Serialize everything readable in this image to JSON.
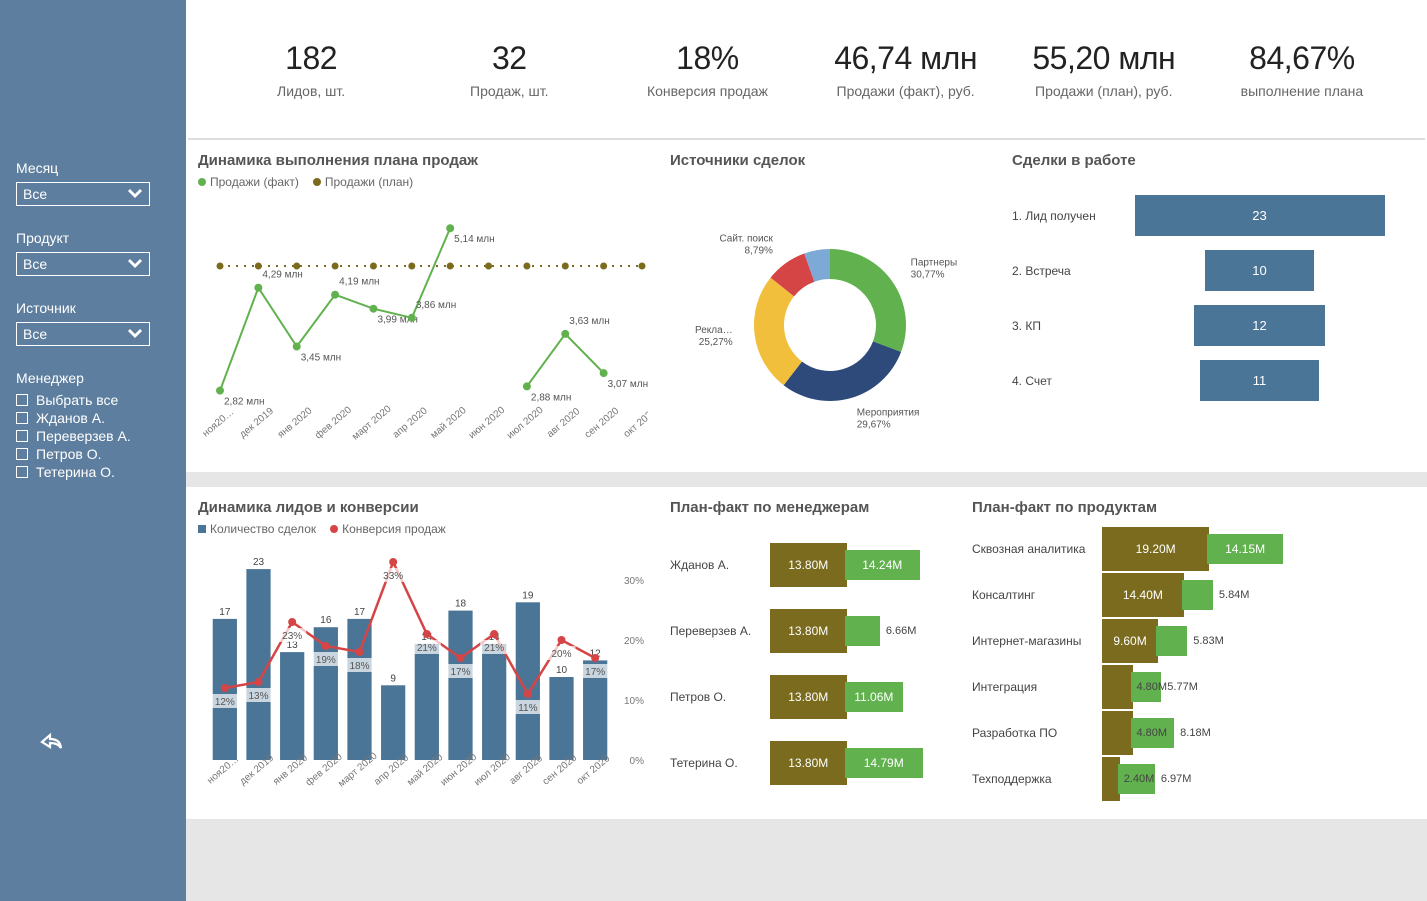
{
  "sidebar": {
    "filters": {
      "month_label": "Месяц",
      "month_value": "Все",
      "product_label": "Продукт",
      "product_value": "Все",
      "source_label": "Источник",
      "source_value": "Все",
      "manager_label": "Менеджер",
      "managers": [
        "Выбрать все",
        "Жданов А.",
        "Переверзев А.",
        "Петров О.",
        "Тетерина О."
      ]
    }
  },
  "kpis": [
    {
      "value": "182",
      "label": "Лидов, шт."
    },
    {
      "value": "32",
      "label": "Продаж, шт."
    },
    {
      "value": "18%",
      "label": "Конверсия продаж"
    },
    {
      "value": "46,74 млн",
      "label": "Продажи (факт), руб."
    },
    {
      "value": "55,20 млн",
      "label": "Продажи (план), руб."
    },
    {
      "value": "84,67%",
      "label": "выполнение плана"
    }
  ],
  "titles": {
    "dynamics_plan": "Динамика выполнения плана продаж",
    "sources": "Источники сделок",
    "funnel": "Сделки в работе",
    "leads_conv": "Динамика лидов и конверсии",
    "pf_managers": "План-факт по менеджерам",
    "pf_products": "План-факт по продуктам"
  },
  "legends": {
    "plan_fact": {
      "fact": "Продажи (факт)",
      "plan": "Продажи (план)"
    },
    "leads_conv": {
      "deals": "Количество сделок",
      "conv": "Конверсия продаж"
    }
  },
  "chart_data": [
    {
      "id": "dynamics_plan",
      "type": "line",
      "title": "Динамика выполнения плана продаж",
      "x": [
        "ноя20…",
        "дек 2019",
        "янв 2020",
        "фев 2020",
        "март 2020",
        "апр 2020",
        "май 2020",
        "июн 2020",
        "июл 2020",
        "авг 2020",
        "сен 2020",
        "окт 2020"
      ],
      "series": [
        {
          "name": "Продажи (факт)",
          "color": "#62b14f",
          "values": [
            2.82,
            4.29,
            3.45,
            4.19,
            3.99,
            3.86,
            5.14,
            null,
            2.88,
            3.63,
            3.07,
            null
          ],
          "data_labels": [
            "2,82 млн",
            "4,29 млн",
            "3,45 млн",
            "4,19 млн",
            "3,99 млн",
            "3,86 млн",
            "5,14 млн",
            "",
            "2,88 млн",
            "3,63 млн",
            "3,07 млн",
            ""
          ]
        },
        {
          "name": "Продажи (план)",
          "color": "#7a6b1e",
          "values": [
            4.6,
            4.6,
            4.6,
            4.6,
            4.6,
            4.6,
            4.6,
            4.6,
            4.6,
            4.6,
            4.6,
            4.6
          ],
          "style": "dashed"
        }
      ],
      "ylim": [
        2.5,
        5.5
      ],
      "y_unit": "млн"
    },
    {
      "id": "sources",
      "type": "pie",
      "title": "Источники сделок",
      "slices": [
        {
          "name": "Партнеры",
          "value": 30.77,
          "label": "30,77%",
          "color": "#62b14f"
        },
        {
          "name": "Мероприятия",
          "value": 29.67,
          "label": "29,67%",
          "color": "#2e4a7a"
        },
        {
          "name": "Рекла…",
          "value": 25.27,
          "label": "25,27%",
          "color": "#f2bf3d"
        },
        {
          "name": "Сайт. поиск",
          "value": 8.79,
          "label": "8,79%",
          "color": "#d64545"
        },
        {
          "name": "",
          "value": 5.5,
          "label": "",
          "color": "#7da9d6"
        }
      ]
    },
    {
      "id": "funnel",
      "type": "bar",
      "title": "Сделки в работе",
      "rows": [
        {
          "label": "1. Лид получен",
          "value": 23
        },
        {
          "label": "2. Встреча",
          "value": 10
        },
        {
          "label": "3. КП",
          "value": 12
        },
        {
          "label": "4. Счет",
          "value": 11
        }
      ]
    },
    {
      "id": "leads_conv",
      "type": "bar+line",
      "title": "Динамика лидов и конверсии",
      "x": [
        "ноя20…",
        "дек 2019",
        "янв 2020",
        "фев 2020",
        "март 2020",
        "апр 2020",
        "май 2020",
        "июн 2020",
        "июл 2020",
        "авг 2020",
        "сен 2020",
        "окт 2020"
      ],
      "bar_series": {
        "name": "Количество сделок",
        "color": "#4b7597",
        "values": [
          17,
          23,
          13,
          16,
          17,
          9,
          14,
          18,
          14,
          19,
          10,
          12
        ],
        "labels": [
          "17",
          "23",
          "13",
          "16",
          "17",
          "9",
          "14",
          "18",
          "14",
          "19",
          "10",
          "12"
        ]
      },
      "line_series": {
        "name": "Конверсия продаж",
        "color": "#d64545",
        "values": [
          12,
          13,
          23,
          19,
          18,
          33,
          21,
          17,
          21,
          11,
          20,
          17
        ],
        "labels": [
          "12%",
          "13%",
          "23%",
          "19%",
          "18%",
          "33%",
          "21%",
          "17%",
          "21%",
          "11%",
          "20%",
          "17%"
        ]
      },
      "right_axis_ticks": [
        "0%",
        "10%",
        "20%",
        "30%"
      ]
    },
    {
      "id": "pf_managers",
      "type": "bar",
      "title": "План-факт по менеджерам",
      "rows": [
        {
          "name": "Жданов А.",
          "plan": 13.8,
          "plan_label": "13.80M",
          "fact": 14.24,
          "fact_label": "14.24M"
        },
        {
          "name": "Переверзев А.",
          "plan": 13.8,
          "plan_label": "13.80M",
          "fact": 6.66,
          "fact_label": "6.66M"
        },
        {
          "name": "Петров О.",
          "plan": 13.8,
          "plan_label": "13.80M",
          "fact": 11.06,
          "fact_label": "11.06M"
        },
        {
          "name": "Тетерина О.",
          "plan": 13.8,
          "plan_label": "13.80M",
          "fact": 14.79,
          "fact_label": "14.79M"
        }
      ]
    },
    {
      "id": "pf_products",
      "type": "bar",
      "title": "План-факт по продуктам",
      "rows": [
        {
          "name": "Сквозная аналитика",
          "plan": 19.2,
          "plan_label": "19.20M",
          "fact": 14.15,
          "fact_label": "14.15M"
        },
        {
          "name": "Консалтинг",
          "plan": 14.4,
          "plan_label": "14.40M",
          "fact": 5.84,
          "fact_label": "5.84M"
        },
        {
          "name": "Интернет-магазины",
          "plan": 9.6,
          "plan_label": "9.60M",
          "fact": 5.83,
          "fact_label": "5.83M"
        },
        {
          "name": "Интеграция",
          "plan": 4.8,
          "plan_label": "4.80M",
          "fact": 5.77,
          "fact_label": "5.77M"
        },
        {
          "name": "Разработка ПО",
          "plan": 4.8,
          "plan_label": "4.80M",
          "fact": 8.18,
          "fact_label": "8.18M"
        },
        {
          "name": "Техподдержка",
          "plan": 2.4,
          "plan_label": "2.40M",
          "fact": 6.97,
          "fact_label": "6.97M"
        }
      ]
    }
  ]
}
